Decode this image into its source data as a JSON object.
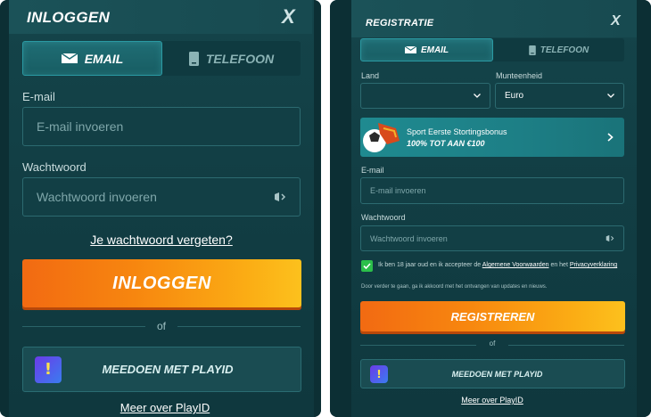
{
  "login": {
    "title": "INLOGGEN",
    "close": "X",
    "tabs": [
      {
        "label": "EMAIL",
        "icon": "envelope-icon",
        "active": true
      },
      {
        "label": "TELEFOON",
        "icon": "phone-icon",
        "active": false
      }
    ],
    "email_label": "E-mail",
    "email_placeholder": "E-mail invoeren",
    "password_label": "Wachtwoord",
    "password_placeholder": "Wachtwoord invoeren",
    "forgot_link": "Je wachtwoord vergeten?",
    "submit": "INLOGGEN",
    "or": "of",
    "playid": "MEEDOEN MET PLAYID",
    "more_playid": "Meer over PlayID"
  },
  "register": {
    "title": "REGISTRATIE",
    "close": "X",
    "tabs": [
      {
        "label": "EMAIL",
        "icon": "envelope-icon",
        "active": true
      },
      {
        "label": "TELEFOON",
        "icon": "phone-icon",
        "active": false
      }
    ],
    "country_label": "Land",
    "country_value": "",
    "currency_label": "Munteenheid",
    "currency_value": "Euro",
    "bonus_title": "Sport Eerste Stortingsbonus",
    "bonus_sub": "100% TOT AAN €100",
    "email_label": "E-mail",
    "email_placeholder": "E-mail invoeren",
    "password_label": "Wachtwoord",
    "password_placeholder": "Wachtwoord invoeren",
    "terms_prefix": "Ik ben 18 jaar oud en ik accepteer de",
    "terms_link": "Algemene Voorwaarden",
    "terms_mid": "en het",
    "privacy_link": "Privacyverklaring",
    "notice": "Door verder te gaan, ga ik akkoord met het ontvangen van updates en nieuws.",
    "submit": "REGISTREREN",
    "or": "of",
    "playid": "MEEDOEN MET PLAYID",
    "more_playid": "Meer over PlayID"
  },
  "colors": {
    "panel_bg": "#14444a",
    "accent_orange": "#f7860f",
    "active_tab": "#1f6d74",
    "checkbox": "#2bbf4a"
  }
}
